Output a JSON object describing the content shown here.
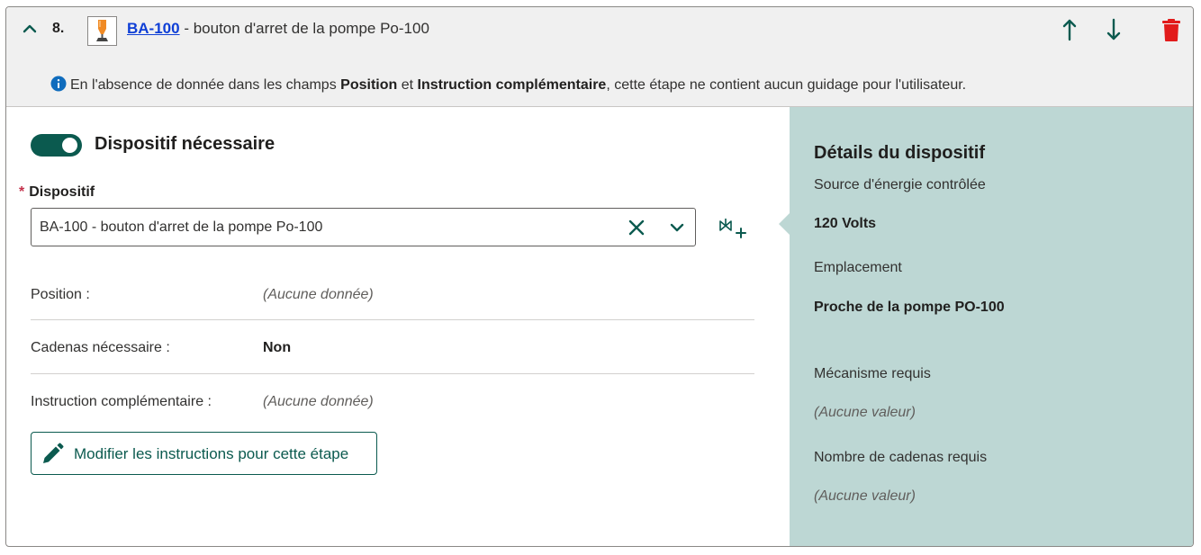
{
  "step": {
    "number": "8.",
    "code": "BA-100",
    "description": " - bouton d'arret de la pompe Po-100",
    "icon": "hand-stop-device-icon"
  },
  "header_actions": {
    "move_up_icon": "arrow-up-icon",
    "move_down_icon": "arrow-down-icon",
    "delete_icon": "trash-icon",
    "accent_color": "#0b5a4f",
    "delete_color": "#e21b1b"
  },
  "info": {
    "part1": "En l'absence de donnée dans les champs ",
    "bold1": "Position",
    "part2": " et ",
    "bold2": "Instruction complémentaire",
    "part3": ", cette étape ne contient aucun guidage pour l'utilisateur."
  },
  "device_toggle": {
    "label": "Dispositif nécessaire",
    "on": true
  },
  "device_field": {
    "required_mark": "*",
    "label": "Dispositif",
    "value": "BA-100 - bouton d'arret de la pompe Po-100"
  },
  "fields": {
    "position_label": "Position :",
    "position_value": "(Aucune donnée)",
    "locks_label": "Cadenas nécessaire :",
    "locks_value": "Non",
    "instruction_label": "Instruction complémentaire :",
    "instruction_value": "(Aucune donnée)"
  },
  "edit_button": {
    "label": "Modifier les instructions pour cette étape"
  },
  "details": {
    "title": "Détails du dispositif",
    "energy_label": "Source d'énergie contrôlée",
    "energy_value": "120 Volts",
    "location_label": "Emplacement",
    "location_value": "Proche de la pompe PO-100",
    "mechanism_label": "Mécanisme requis",
    "mechanism_value": "(Aucune valeur)",
    "locks_count_label": "Nombre de cadenas requis",
    "locks_count_value": "(Aucune valeur)",
    "panel_color": "#bdd7d4"
  }
}
